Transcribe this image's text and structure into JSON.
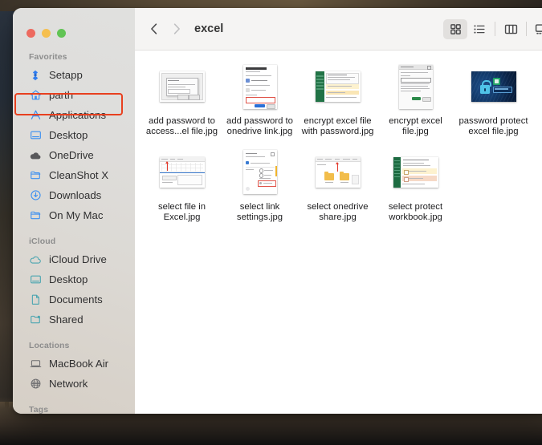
{
  "window": {
    "title": "excel",
    "traffic_lights": [
      {
        "name": "close",
        "color": "#ed6a5f"
      },
      {
        "name": "minimize",
        "color": "#f5bf4f"
      },
      {
        "name": "maximize",
        "color": "#61c454"
      }
    ]
  },
  "toolbar": {
    "back_label": "‹",
    "forward_label": "›",
    "title": "excel",
    "view_buttons": [
      {
        "name": "icon-view",
        "icon": "grid-icon",
        "active": true
      },
      {
        "name": "list-view",
        "icon": "list-icon",
        "active": false
      },
      {
        "name": "column-view",
        "icon": "columns-icon",
        "active": false
      },
      {
        "name": "gallery-view",
        "icon": "gallery-icon",
        "active": false
      }
    ]
  },
  "sidebar": {
    "sections": [
      {
        "title": "Favorites",
        "items": [
          {
            "label": "Setapp",
            "icon": "setapp-icon"
          },
          {
            "label": "parth",
            "icon": "home-icon"
          },
          {
            "label": "Applications",
            "icon": "applications-icon",
            "highlighted": true
          },
          {
            "label": "Desktop",
            "icon": "desktop-icon"
          },
          {
            "label": "OneDrive",
            "icon": "onedrive-cloud-icon"
          },
          {
            "label": "CleanShot X",
            "icon": "folder-icon"
          },
          {
            "label": "Downloads",
            "icon": "downloads-icon"
          },
          {
            "label": "On My Mac",
            "icon": "folder-icon"
          }
        ]
      },
      {
        "title": "iCloud",
        "items": [
          {
            "label": "iCloud Drive",
            "icon": "cloud-icon"
          },
          {
            "label": "Desktop",
            "icon": "desktop-icon"
          },
          {
            "label": "Documents",
            "icon": "document-icon"
          },
          {
            "label": "Shared",
            "icon": "shared-folder-icon"
          }
        ]
      },
      {
        "title": "Locations",
        "items": [
          {
            "label": "MacBook Air",
            "icon": "laptop-icon"
          },
          {
            "label": "Network",
            "icon": "globe-icon"
          }
        ]
      },
      {
        "title": "Tags",
        "items": []
      }
    ],
    "annotation": {
      "color": "#e8401f",
      "target": "Applications"
    }
  },
  "files": [
    {
      "name": "add password to access...el file.jpg",
      "thumb": "dialog-landscape"
    },
    {
      "name": "add password to onedrive link.jpg",
      "thumb": "link-settings-portrait"
    },
    {
      "name": "encrypt excel file with password.jpg",
      "thumb": "excel-sheet-landscape"
    },
    {
      "name": "encrypt excel file.jpg",
      "thumb": "encrypt-dialog-portrait"
    },
    {
      "name": "password protect excel file.jpg",
      "thumb": "lock-poster-landscape"
    },
    {
      "name": "select file in Excel.jpg",
      "thumb": "select-file-landscape"
    },
    {
      "name": "select link settings.jpg",
      "thumb": "link-settings2-portrait"
    },
    {
      "name": "select onedrive share.jpg",
      "thumb": "onedrive-folders-landscape"
    },
    {
      "name": "select protect workbook.jpg",
      "thumb": "protect-workbook-landscape"
    }
  ]
}
